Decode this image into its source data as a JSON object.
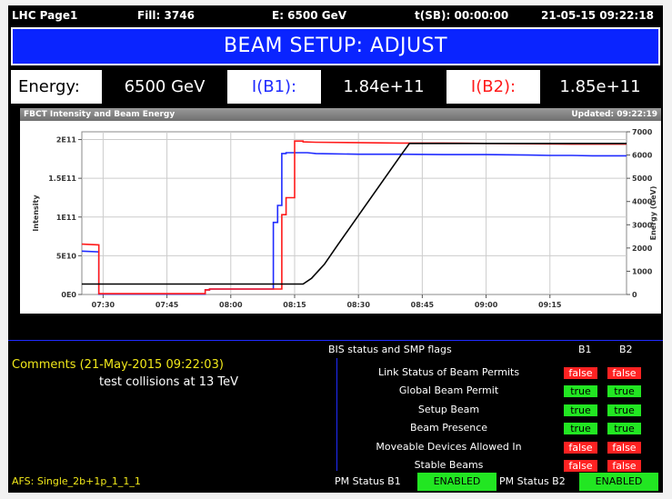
{
  "header": {
    "page": "LHC Page1",
    "fill": "Fill: 3746",
    "energy": "E:  6500 GeV",
    "tsb": "t(SB): 00:00:00",
    "datetime": "21-05-15 09:22:18"
  },
  "title": "BEAM SETUP: ADJUST",
  "summary": {
    "energy_label": "Energy:",
    "energy_value": "6500 GeV",
    "ib1_label": "I(B1):",
    "ib1_value": "1.84e+11",
    "ib2_label": "I(B2):",
    "ib2_value": "1.85e+11"
  },
  "chart_header": {
    "title": "FBCT Intensity and Beam Energy",
    "updated": "Updated: 09:22:19"
  },
  "chart_data": {
    "type": "line",
    "xlabel": "",
    "ylabel": "Intensity",
    "y2label": "Energy (GeV)",
    "ylim": [
      0,
      210000000000.0
    ],
    "y2lim": [
      0,
      7000
    ],
    "xlim_minutes": [
      -5,
      123
    ],
    "x_tick_labels": [
      "07:30",
      "07:45",
      "08:00",
      "08:15",
      "08:30",
      "08:45",
      "09:00",
      "09:15"
    ],
    "x_tick_minutes": [
      0,
      15,
      30,
      45,
      60,
      75,
      90,
      105
    ],
    "y_tick_labels": [
      "0E0",
      "5E10",
      "1E11",
      "1.5E11",
      "2E11"
    ],
    "y_tick_values": [
      0,
      50000000000.0,
      100000000000.0,
      150000000000.0,
      200000000000.0
    ],
    "y2_tick_labels": [
      "0",
      "1000",
      "2000",
      "3000",
      "4000",
      "5000",
      "6000",
      "7000"
    ],
    "y2_tick_values": [
      0,
      1000,
      2000,
      3000,
      4000,
      5000,
      6000,
      7000
    ],
    "grid": true,
    "series": [
      {
        "color": "#1f2bff",
        "axis": "left",
        "x": [
          -5,
          -1,
          -1,
          24,
          24,
          25,
          25,
          40,
          40,
          41,
          41,
          42,
          42,
          43,
          43,
          48,
          50,
          60,
          70,
          80,
          90,
          100,
          105,
          110,
          115,
          123
        ],
        "y": [
          56000000000.0,
          55000000000.0,
          500000000.0,
          500000000.0,
          6000000000.0,
          6000000000.0,
          7000000000.0,
          7000000000.0,
          93000000000.0,
          93000000000.0,
          115000000000.0,
          115000000000.0,
          182000000000.0,
          182000000000.0,
          183000000000.0,
          183000000000.0,
          182000000000.0,
          181000000000.0,
          181000000000.0,
          180500000000.0,
          180500000000.0,
          180000000000.0,
          179500000000.0,
          179500000000.0,
          179000000000.0,
          179000000000.0
        ]
      },
      {
        "color": "#ff1a1a",
        "axis": "left",
        "x": [
          -5,
          -1,
          -1,
          24,
          24,
          25,
          25,
          42,
          42,
          43,
          43,
          45,
          45,
          47,
          47,
          50,
          60,
          70,
          80,
          90,
          100,
          110,
          123
        ],
        "y": [
          65000000000.0,
          64000000000.0,
          1000000000.0,
          1000000000.0,
          6000000000.0,
          6000000000.0,
          7000000000.0,
          7000000000.0,
          103000000000.0,
          103000000000.0,
          125000000000.0,
          125000000000.0,
          198000000000.0,
          198000000000.0,
          197000000000.0,
          196500000000.0,
          196000000000.0,
          195500000000.0,
          195500000000.0,
          195000000000.0,
          194500000000.0,
          194000000000.0,
          194000000000.0
        ]
      },
      {
        "color": "#000000",
        "axis": "right",
        "x": [
          -5,
          47,
          49,
          52,
          55,
          60,
          65,
          70,
          72,
          80,
          90,
          100,
          110,
          123
        ],
        "y": [
          450,
          450,
          700,
          1300,
          2100,
          3400,
          4700,
          6000,
          6500,
          6500,
          6500,
          6500,
          6500,
          6500
        ]
      }
    ]
  },
  "comments": {
    "title": "Comments (21-May-2015 09:22:03)",
    "text": "test collisions at 13 TeV"
  },
  "bis": {
    "heading": "BIS status and SMP flags",
    "col_b1": "B1",
    "col_b2": "B2",
    "rows": [
      {
        "name": "Link Status of Beam Permits",
        "b1": "false",
        "b2": "false"
      },
      {
        "name": "Global Beam Permit",
        "b1": "true",
        "b2": "true"
      },
      {
        "name": "Setup Beam",
        "b1": "true",
        "b2": "true"
      },
      {
        "name": "Beam Presence",
        "b1": "true",
        "b2": "true"
      },
      {
        "name": "Moveable Devices Allowed In",
        "b1": "false",
        "b2": "false"
      },
      {
        "name": "Stable Beams",
        "b1": "false",
        "b2": "false"
      }
    ]
  },
  "footer": {
    "afs": "AFS: Single_2b+1p_1_1_1",
    "pm_b1_label": "PM Status B1",
    "pm_b1_value": "ENABLED",
    "pm_b2_label": "PM Status B2",
    "pm_b2_value": "ENABLED"
  },
  "colors": {
    "title_bg": "#0a24ff",
    "b1": "#1f2bff",
    "b2": "#ff1a1a",
    "energy": "#000000",
    "true_flag": "#22e622",
    "false_flag": "#ff2222",
    "comment_yellow": "#f1e81a"
  }
}
